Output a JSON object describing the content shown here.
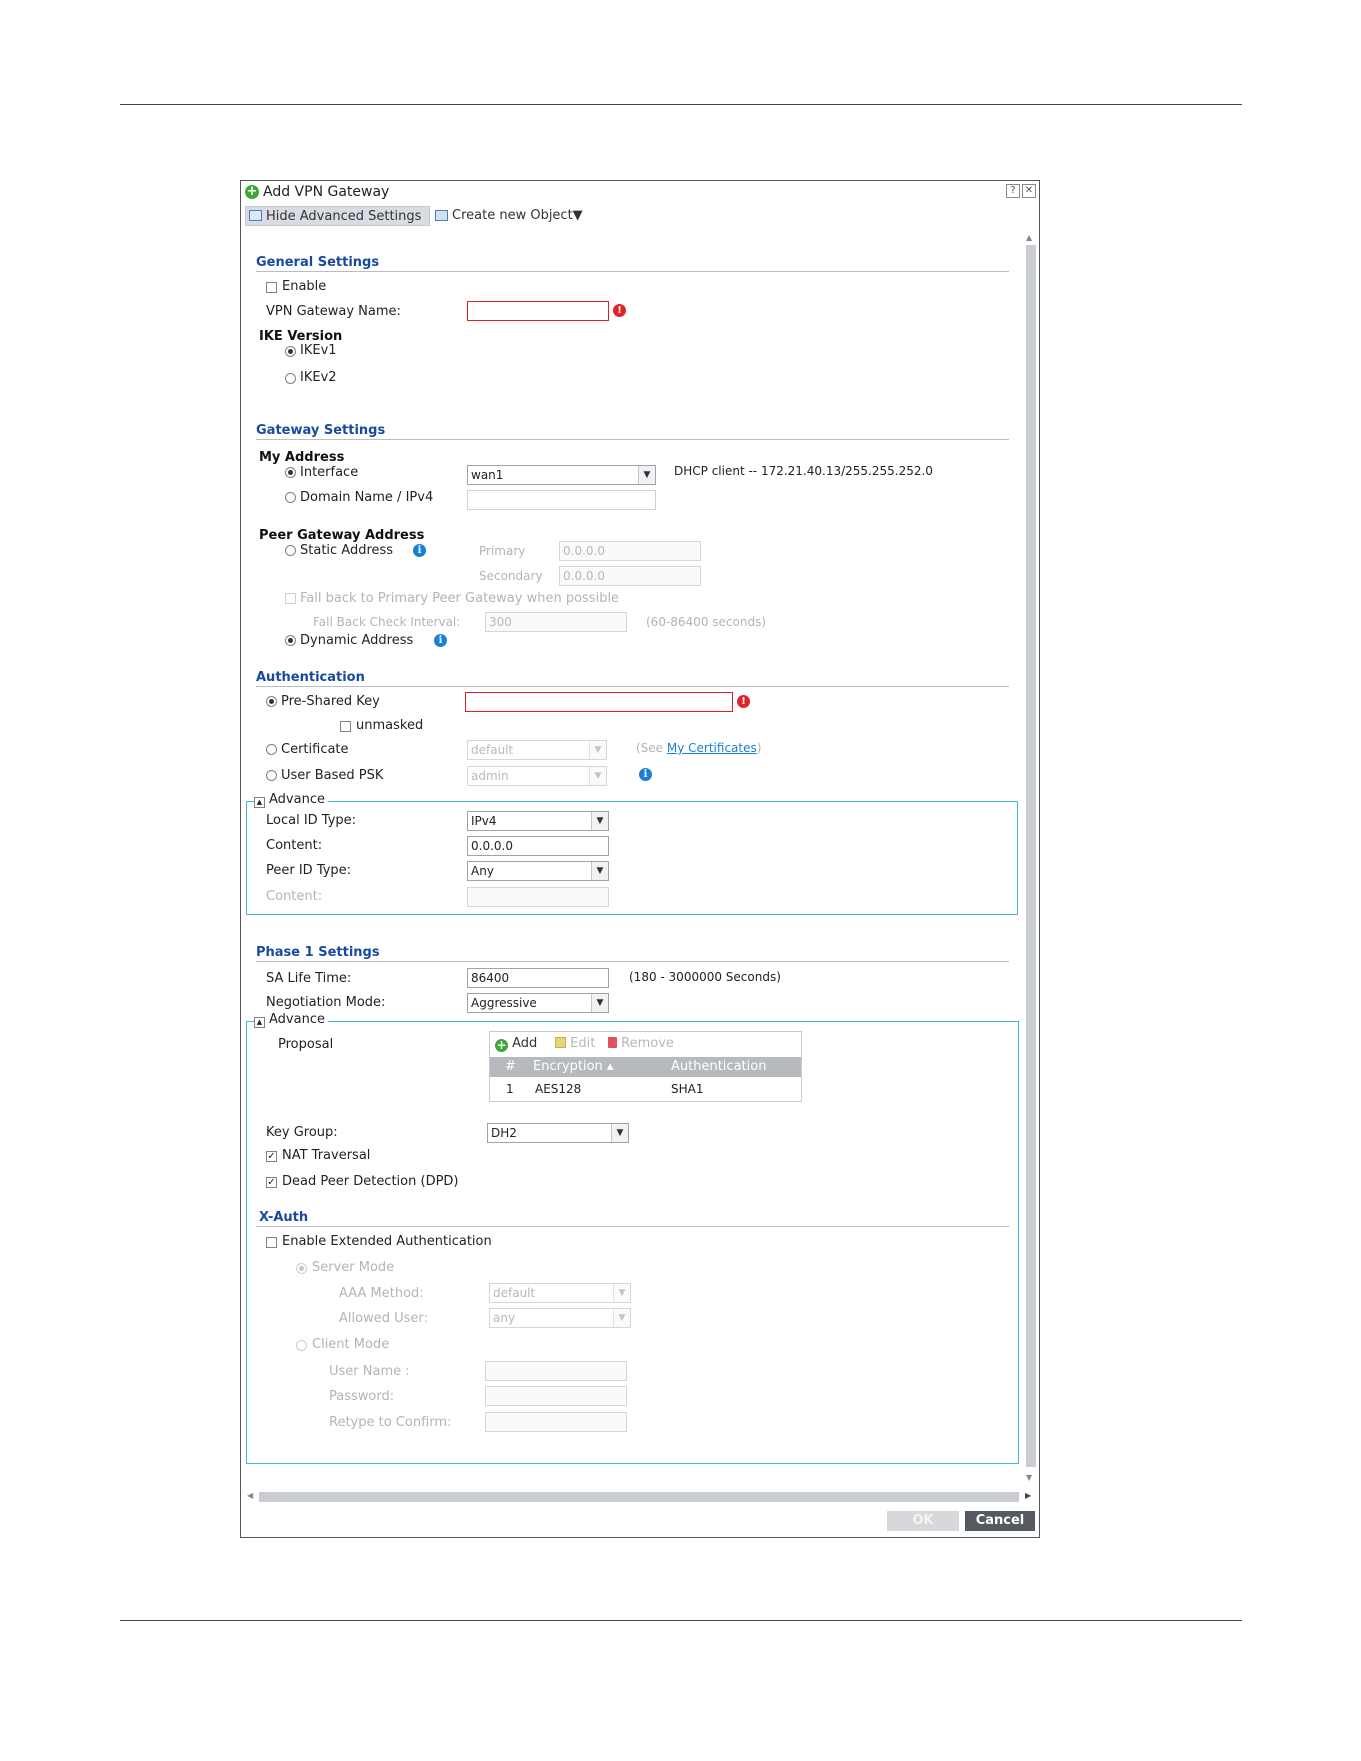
{
  "dialog": {
    "title": "Add VPN Gateway",
    "help_glyph": "?",
    "close_glyph": "✕",
    "toolbar": {
      "hide_advanced": "Hide Advanced Settings",
      "create_object": "Create new Object▼"
    }
  },
  "general": {
    "title": "General Settings",
    "enable_label": "Enable",
    "enable_checked": false,
    "gateway_name_label": "VPN Gateway Name:",
    "gateway_name_value": "",
    "ike_version_label": "IKE Version",
    "ikev1_label": "IKEv1",
    "ikev2_label": "IKEv2",
    "ike_selected": "IKEv1"
  },
  "gateway": {
    "title": "Gateway Settings",
    "my_address_label": "My Address",
    "interface_label": "Interface",
    "interface_value": "wan1",
    "interface_info": "DHCP client -- 172.21.40.13/255.255.252.0",
    "domain_label": "Domain Name / IPv4",
    "domain_value": "",
    "peer_label": "Peer Gateway Address",
    "static_label": "Static Address",
    "primary_label": "Primary",
    "primary_value": "0.0.0.0",
    "secondary_label": "Secondary",
    "secondary_value": "0.0.0.0",
    "fallback_label": "Fall back to Primary Peer Gateway when possible",
    "fallback_interval_label": "Fall Back Check Interval:",
    "fallback_interval_value": "300",
    "fallback_range": "(60-86400 seconds)",
    "dynamic_label": "Dynamic Address"
  },
  "auth": {
    "title": "Authentication",
    "psk_label": "Pre-Shared Key",
    "psk_value": "",
    "unmasked_label": "unmasked",
    "certificate_label": "Certificate",
    "certificate_value": "default",
    "see_prefix": "(See ",
    "see_link": "My Certificates",
    "see_suffix": ")",
    "userpsk_label": "User Based PSK",
    "userpsk_value": "admin",
    "advance_legend": "Advance",
    "local_id_type_label": "Local ID Type:",
    "local_id_type_value": "IPv4",
    "content_label": "Content:",
    "content_value": "0.0.0.0",
    "peer_id_type_label": "Peer ID Type:",
    "peer_id_type_value": "Any",
    "peer_content_label": "Content:",
    "peer_content_value": ""
  },
  "phase1": {
    "title": "Phase 1 Settings",
    "sa_life_label": "SA Life Time:",
    "sa_life_value": "86400",
    "sa_life_range": "(180 - 3000000 Seconds)",
    "negotiation_label": "Negotiation Mode:",
    "negotiation_value": "Aggressive",
    "advance_legend": "Advance",
    "proposal_label": "Proposal",
    "proposal_toolbar": {
      "add": "Add",
      "edit": "Edit",
      "remove": "Remove"
    },
    "proposal_columns": [
      "#",
      "Encryption ▴",
      "Authentication"
    ],
    "proposal_rows": [
      {
        "num": "1",
        "encryption": "AES128",
        "authentication": "SHA1"
      }
    ],
    "key_group_label": "Key Group:",
    "key_group_value": "DH2",
    "nat_label": "NAT Traversal",
    "nat_checked": true,
    "dpd_label": "Dead Peer Detection (DPD)",
    "dpd_checked": true
  },
  "xauth": {
    "title": "X-Auth",
    "enable_label": "Enable Extended Authentication",
    "server_mode_label": "Server Mode",
    "aaa_label": "AAA Method:",
    "aaa_value": "default",
    "allowed_label": "Allowed User:",
    "allowed_value": "any",
    "client_mode_label": "Client Mode",
    "username_label": "User Name :",
    "password_label": "Password:",
    "retype_label": "Retype to Confirm:"
  },
  "buttons": {
    "ok": "OK",
    "cancel": "Cancel"
  },
  "colors": {
    "section_title": "#1a4aa0",
    "error_border": "#e02020",
    "fieldset_border": "#44b6d8",
    "link": "#1a7fd9"
  },
  "scroll": {
    "vertical_thumb_fraction": 0.9
  }
}
